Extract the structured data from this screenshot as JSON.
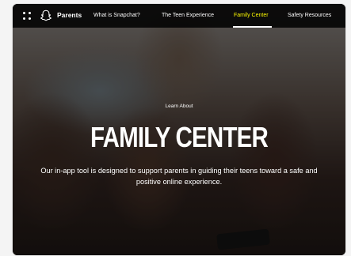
{
  "nav": {
    "brand": "Parents",
    "links": [
      {
        "label": "What is Snapchat?",
        "active": false
      },
      {
        "label": "The Teen Experience",
        "active": false
      },
      {
        "label": "Family Center",
        "active": true
      },
      {
        "label": "Safety Resources",
        "active": false
      }
    ],
    "active_color": "#fffc00"
  },
  "hero": {
    "eyebrow": "Learn About",
    "title": "FAMILY CENTER",
    "description": "Our in-app tool is designed to support parents in guiding their teens toward a safe and positive online experience."
  },
  "icons": {
    "menu": "grid-menu-icon",
    "logo": "snapchat-ghost-icon"
  }
}
